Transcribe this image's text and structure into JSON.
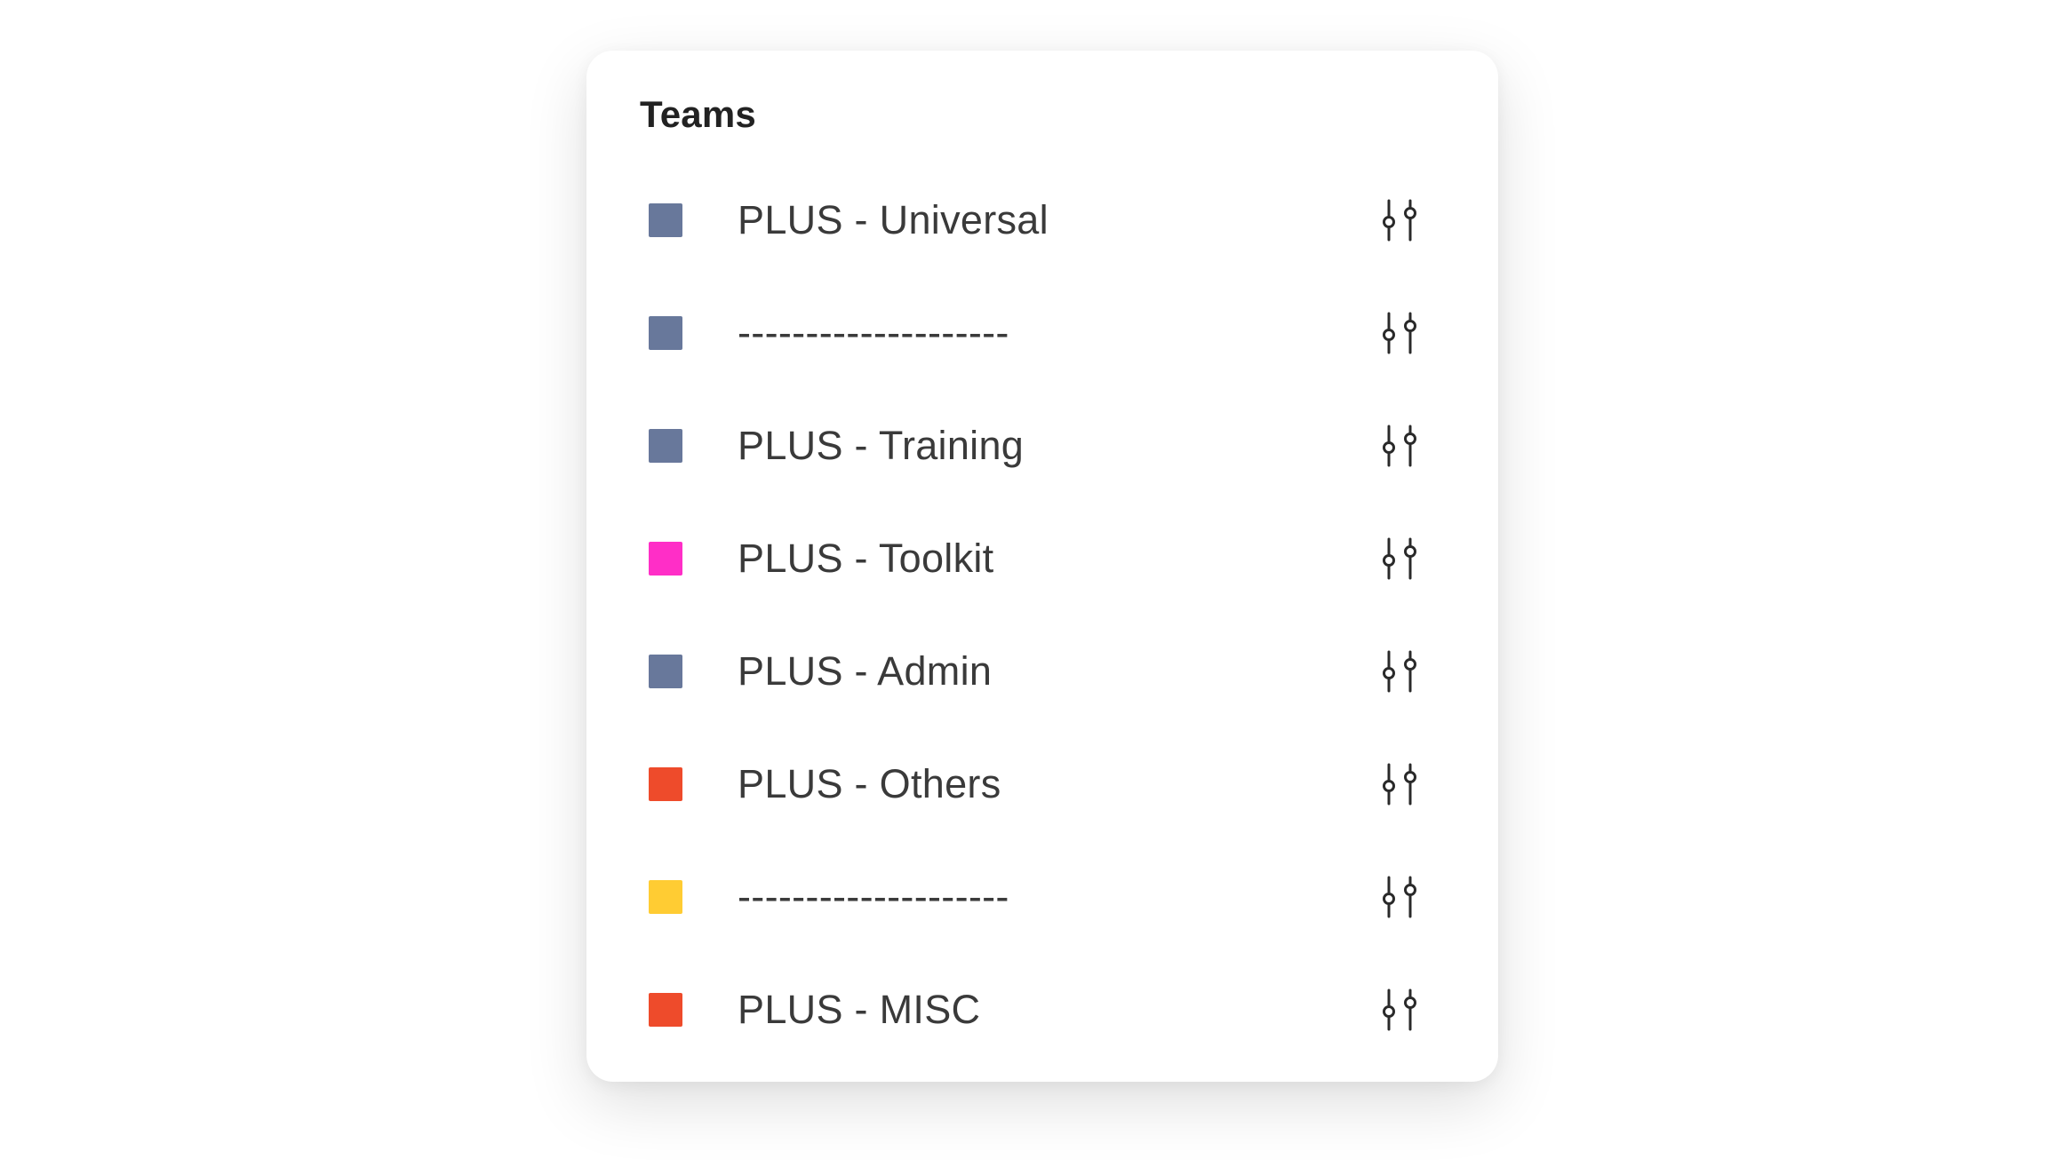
{
  "panel": {
    "title": "Teams"
  },
  "teams": [
    {
      "name": "PLUS - Universal",
      "color": "#68789b",
      "action_icon": "sliders-icon"
    },
    {
      "name": "--------------------",
      "color": "#68789b",
      "action_icon": "sliders-icon"
    },
    {
      "name": "PLUS - Training",
      "color": "#68789b",
      "action_icon": "sliders-icon"
    },
    {
      "name": "PLUS - Toolkit",
      "color": "#ff2ec7",
      "action_icon": "sliders-icon"
    },
    {
      "name": "PLUS - Admin",
      "color": "#68789b",
      "action_icon": "sliders-icon"
    },
    {
      "name": "PLUS - Others",
      "color": "#ee4b2b",
      "action_icon": "sliders-icon"
    },
    {
      "name": "--------------------",
      "color": "#ffcc33",
      "action_icon": "sliders-icon"
    },
    {
      "name": "PLUS - MISC",
      "color": "#ee4b2b",
      "action_icon": "sliders-icon"
    }
  ]
}
